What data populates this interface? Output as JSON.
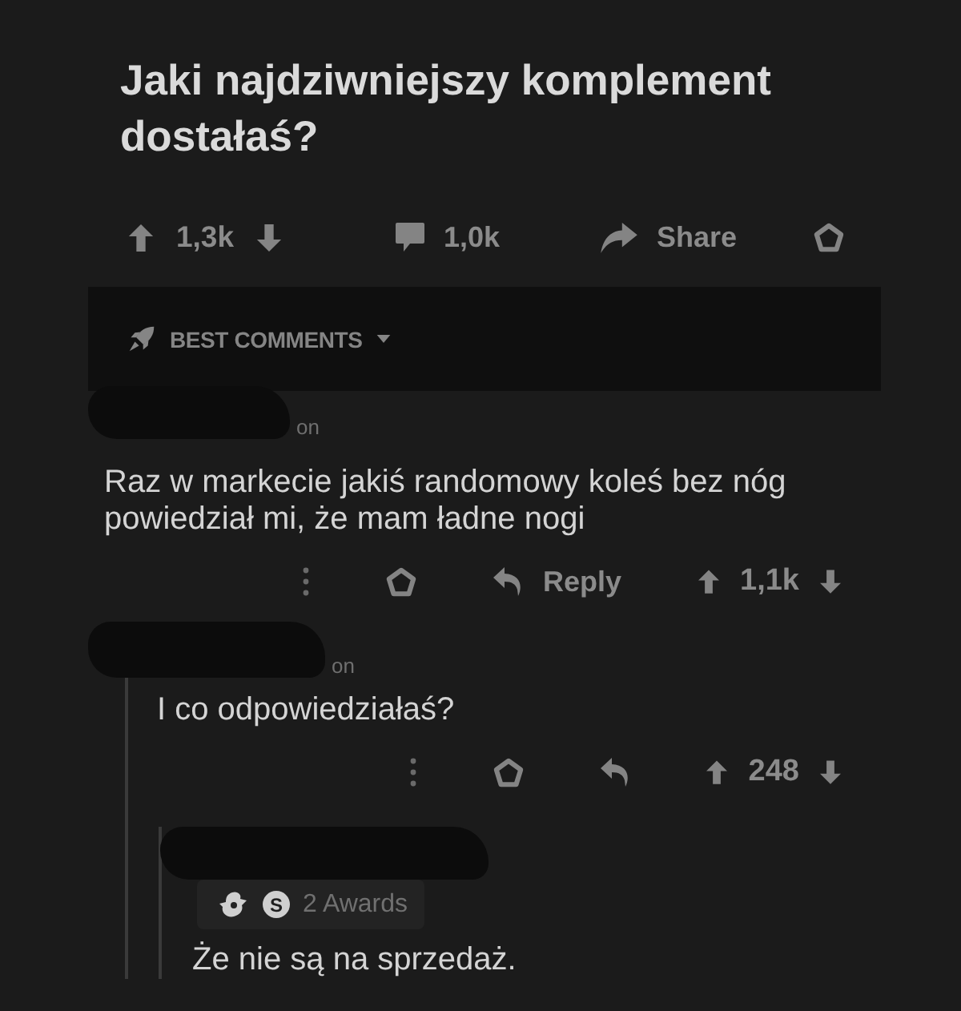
{
  "post": {
    "title": "Jaki najdziwniejszy komplement dostałaś?",
    "score": "1,3k",
    "comment_count": "1,0k",
    "share_label": "Share"
  },
  "sort": {
    "label": "BEST COMMENTS"
  },
  "comments": [
    {
      "meta": "on",
      "body": "Raz w markecie jakiś randomowy koleś bez nóg powiedział mi, że mam ładne nogi",
      "reply_label": "Reply",
      "score": "1,1k",
      "children": [
        {
          "meta": "on",
          "body": "I co odpowiedziałaś?",
          "score": "248",
          "children": [
            {
              "awards": {
                "items": [
                  {
                    "kind": "figure"
                  },
                  {
                    "kind": "coin",
                    "letter": "S"
                  }
                ],
                "label": "2 Awards"
              },
              "body": "Że nie są na sprzedaż."
            }
          ]
        }
      ]
    }
  ]
}
